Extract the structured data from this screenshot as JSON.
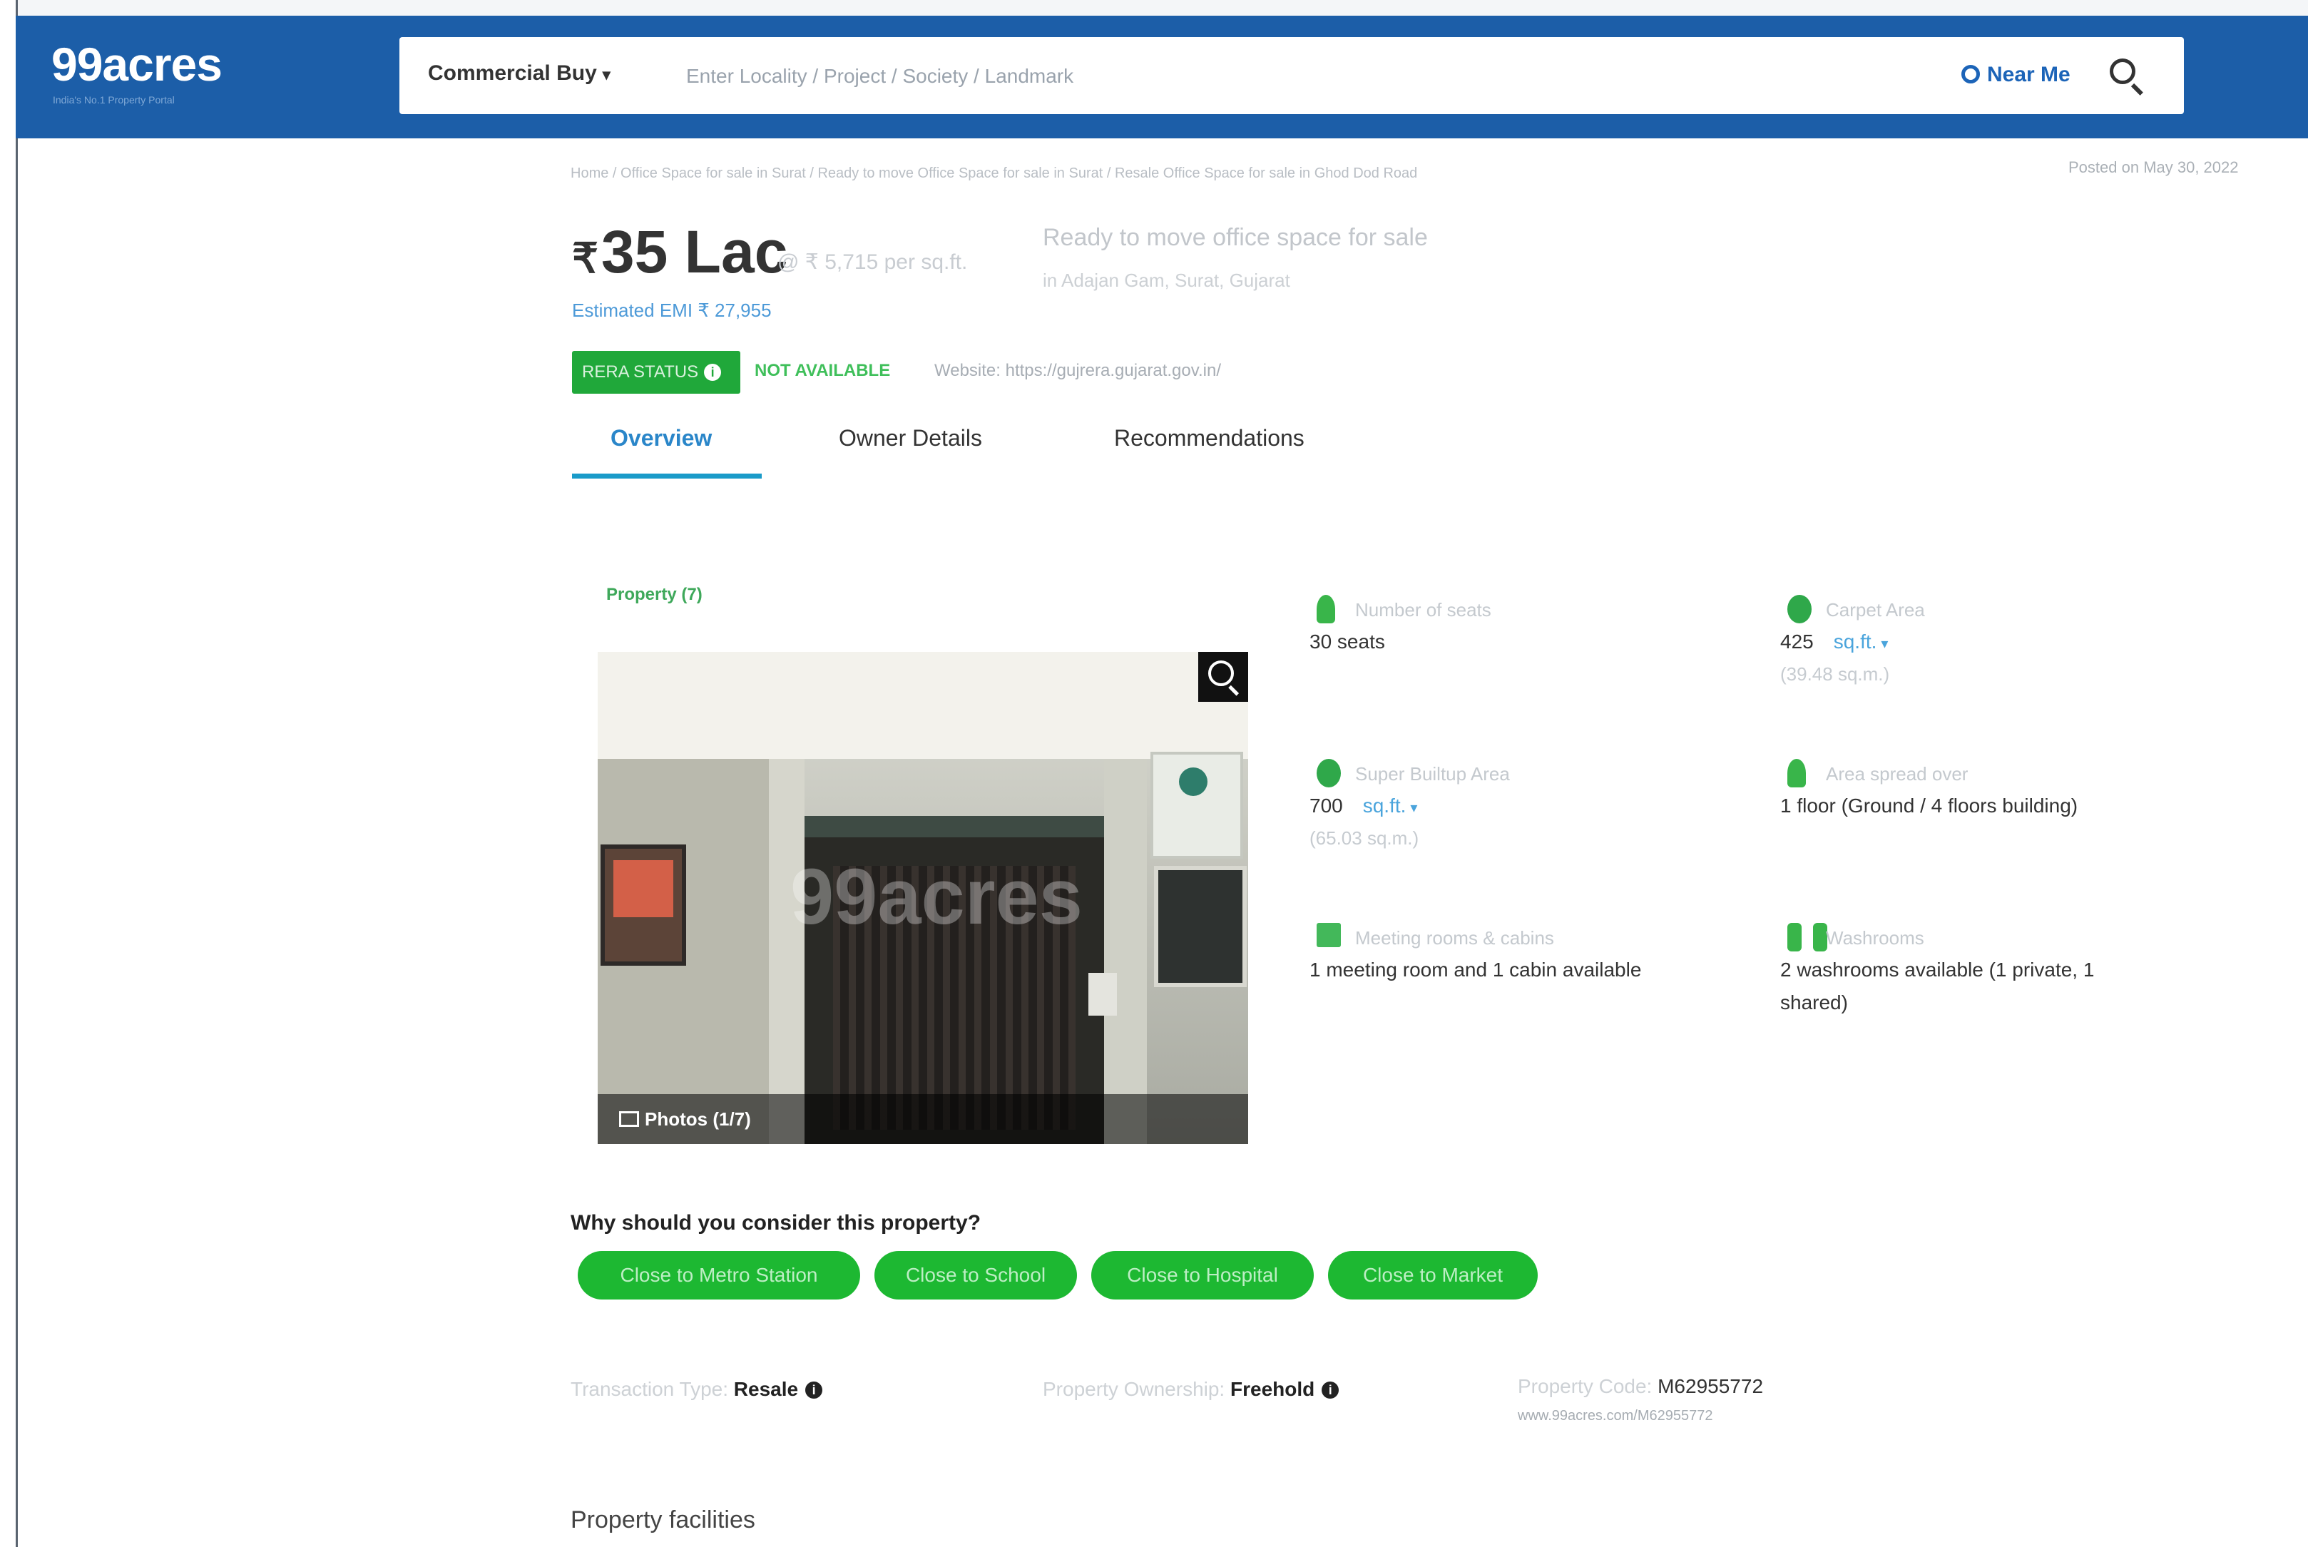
{
  "header": {
    "logo": "99acres",
    "logo_tagline": "India's No.1 Property Portal",
    "search_type": "Commercial Buy",
    "search_placeholder": "Enter Locality / Project / Society / Landmark",
    "near_me": "Near Me"
  },
  "breadcrumb": "Home / Office Space for sale in Surat / Ready to move Office Space for sale in Surat / Resale Office Space for sale in Ghod Dod Road",
  "posted": "Posted on May 30, 2022",
  "listing": {
    "currency": "₹",
    "price": "35 Lac",
    "price_per_sqft": "@ ₹ 5,715 per sq.ft.",
    "emi": "Estimated EMI ₹ 27,955",
    "headline": "Ready to move office space for sale",
    "subline": "in Adajan Gam, Surat, Gujarat"
  },
  "rera": {
    "badge": "RERA STATUS",
    "status": "NOT AVAILABLE",
    "website": "Website: https://gujrera.gujarat.gov.in/"
  },
  "tabs": [
    "Overview",
    "Owner Details",
    "Recommendations"
  ],
  "gallery": {
    "label": "Property (7)",
    "watermark": "99acres",
    "photos_count": "Photos (1/7)"
  },
  "features": {
    "seats": {
      "label": "Number of seats",
      "value": "30 seats"
    },
    "carpet": {
      "label": "Carpet Area",
      "value": "425",
      "unit": "sq.ft.",
      "sub": "(39.48 sq.m.)"
    },
    "super_builtup": {
      "label": "Super Builtup Area",
      "value": "700",
      "unit": "sq.ft.",
      "sub": "(65.03 sq.m.)"
    },
    "spread": {
      "label": "Area spread over",
      "value": "1 floor (Ground / 4 floors building)"
    },
    "meeting": {
      "label": "Meeting rooms & cabins",
      "value": "1 meeting room and 1 cabin available"
    },
    "washrooms": {
      "label": "Washrooms",
      "value": "2 washrooms available (1 private, 1",
      "value2": "shared)"
    }
  },
  "why": {
    "title": "Why should you consider this property?",
    "chips": [
      "Close to Metro Station",
      "Close to School",
      "Close to Hospital",
      "Close to Market"
    ]
  },
  "meta": {
    "transaction_label": "Transaction Type:",
    "transaction_value": "Resale",
    "ownership_label": "Property Ownership:",
    "ownership_value": "Freehold",
    "code_label": "Property Code:",
    "code_value": "M62955772",
    "code_url": "www.99acres.com/M62955772"
  },
  "facilities_title": "Property facilities",
  "colors": {
    "header_blue": "#1c5ea8",
    "accent_green": "#1db832",
    "link_blue": "#2a86c9"
  }
}
